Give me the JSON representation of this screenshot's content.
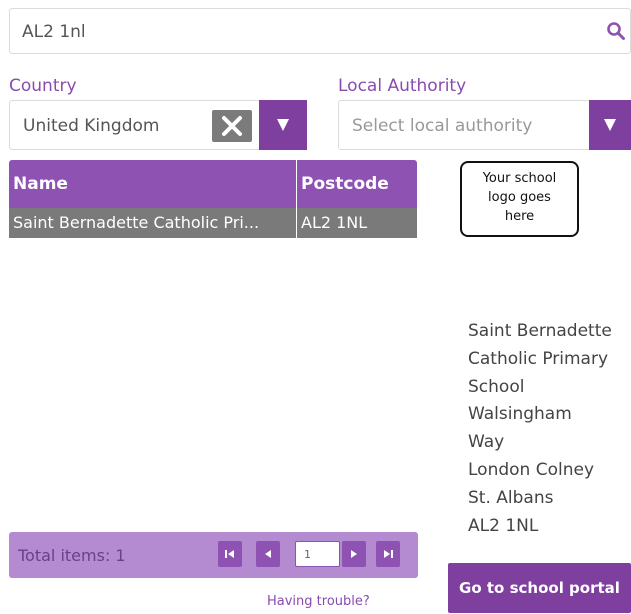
{
  "search": {
    "value": "AL2 1nl"
  },
  "country": {
    "label": "Country",
    "selected": "United Kingdom"
  },
  "local_authority": {
    "label": "Local Authority",
    "placeholder": "Select local authority"
  },
  "grid": {
    "columns": [
      "Name",
      "Postcode"
    ],
    "rows": [
      {
        "name": "Saint Bernadette Catholic Pri...",
        "postcode": "AL2 1NL"
      }
    ]
  },
  "logo": {
    "lines": [
      "Your school",
      "logo goes",
      "here"
    ]
  },
  "address": {
    "lines": [
      "Saint Bernadette",
      "Catholic Primary",
      "School",
      "Walsingham",
      "Way",
      "London Colney",
      "St. Albans",
      "AL2 1NL"
    ]
  },
  "pager": {
    "total_label": "Total items: 1",
    "page": "1"
  },
  "links": {
    "trouble": "Having trouble?"
  },
  "buttons": {
    "portal": "Go to school portal"
  },
  "colors": {
    "accent": "#8e52b2",
    "accent_dark": "#7e3f9f",
    "row_selected": "#7a7a7a"
  }
}
